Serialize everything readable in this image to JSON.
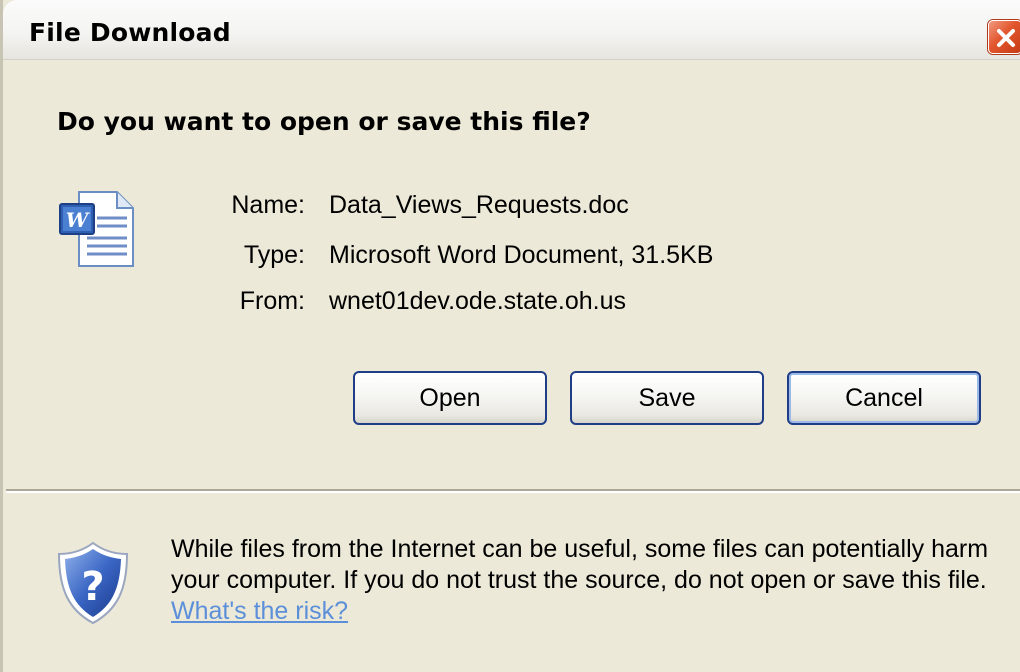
{
  "dialog": {
    "title": "File Download",
    "question": "Do you want to open or save this file?"
  },
  "file": {
    "icon": "word-document-icon",
    "name_label": "Name:",
    "name_value": "Data_Views_Requests.doc",
    "type_label": "Type:",
    "type_value": "Microsoft Word Document, 31.5KB",
    "from_label": "From:",
    "from_value": "wnet01dev.ode.state.oh.us"
  },
  "buttons": {
    "open": "Open",
    "save": "Save",
    "cancel": "Cancel"
  },
  "warning": {
    "icon": "shield-question-icon",
    "text": "While files from the Internet can be useful, some files can potentially harm your computer. If you do not trust the source, do not open or save this file. ",
    "link": "What's the risk?"
  },
  "colors": {
    "button_border": "#1f3e87",
    "link": "#5c8fd9",
    "close_button": "#e2562e",
    "background": "#ece9d8"
  }
}
